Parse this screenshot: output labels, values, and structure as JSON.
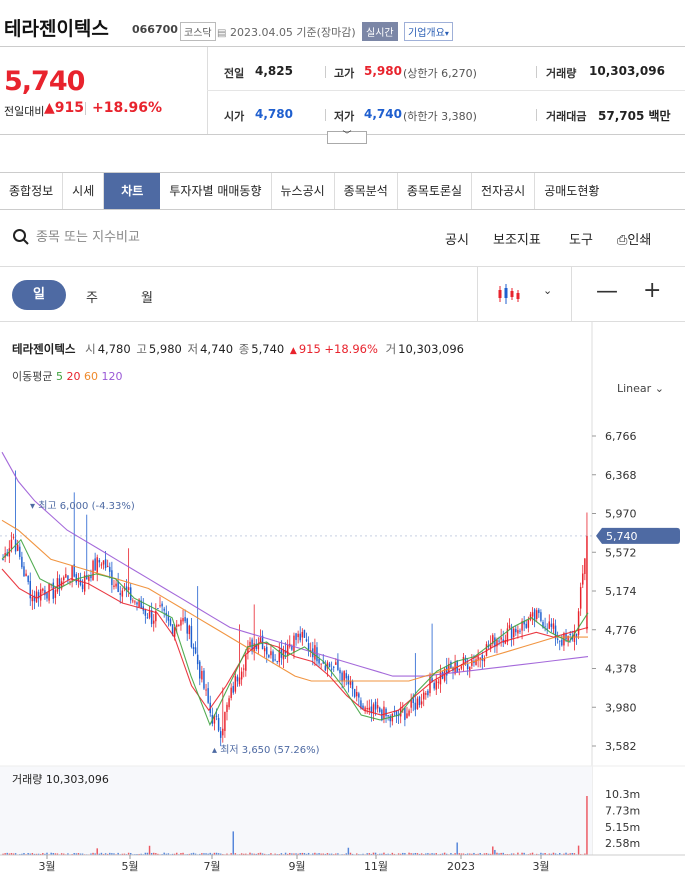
{
  "header": {
    "name": "테라젠이텍스",
    "code": "066700",
    "market": "코스닥",
    "date": "2023.04.05 기준(장마감)",
    "live": "실시간",
    "company_info": "기업개요"
  },
  "quote": {
    "price": "5,740",
    "change_label": "전일대비",
    "change_amount": "915",
    "change_pct": "+18.96%",
    "stats": {
      "prev_label": "전일",
      "prev_value": "4,825",
      "high_label": "고가",
      "high_value": "5,980",
      "upper_limit": "(상한가 6,270)",
      "volume_label": "거래량",
      "volume_value": "10,303,096",
      "open_label": "시가",
      "open_value": "4,780",
      "low_label": "저가",
      "low_value": "4,740",
      "lower_limit": "(하한가 3,380)",
      "amount_label": "거래대금",
      "amount_value": "57,705",
      "amount_unit": "백만"
    }
  },
  "tabs": [
    "종합정보",
    "시세",
    "차트",
    "투자자별 매매동향",
    "뉴스공시",
    "종목분석",
    "종목토론실",
    "전자공시",
    "공매도현황"
  ],
  "active_tab": 2,
  "toolbar": {
    "search_placeholder": "종목 또는 지수비교",
    "disclosure": "공시",
    "indicators": "보조지표",
    "tools": "도구",
    "print": "인쇄"
  },
  "periods": {
    "day": "일",
    "week": "주",
    "month": "월"
  },
  "colors": {
    "up": "#e8232d",
    "down": "#1f5fcf",
    "accent": "#4e6aa3",
    "ma5": "#3fa33f",
    "ma20": "#e8232d",
    "ma60": "#ef8a2c",
    "ma120": "#9a59d6"
  },
  "legend": {
    "name": "테라젠이텍스",
    "open_k": "시",
    "open_v": "4,780",
    "high_k": "고",
    "high_v": "5,980",
    "low_k": "저",
    "low_v": "4,740",
    "close_k": "종",
    "close_v": "5,740",
    "change": "915 +18.96%",
    "vol_k": "거",
    "vol_v": "10,303,096",
    "ma_label": "이동평균",
    "ma": [
      "5",
      "20",
      "60",
      "120"
    ],
    "scale": "Linear"
  },
  "chart_data": {
    "type": "candlestick",
    "y_ticks": [
      "6,766",
      "6,368",
      "5,970",
      "5,572",
      "5,174",
      "4,776",
      "4,378",
      "3,980",
      "3,582"
    ],
    "ylim": [
      3582,
      6766
    ],
    "current_price_label": "5,740",
    "high_annotation": "최고 6,000 (-4.33%)",
    "low_annotation": "최저 3,650 (57.26%)",
    "x_labels": [
      "3월",
      "5월",
      "7월",
      "9월",
      "11월",
      "2023",
      "3월"
    ],
    "volume_label": "거래량 10,303,096",
    "volume_ticks": [
      "10.3m",
      "7.73m",
      "5.15m",
      "2.58m"
    ],
    "close_trend": [
      5500,
      5750,
      5400,
      5100,
      5200,
      5150,
      5300,
      5350,
      5250,
      5400,
      5500,
      5300,
      5200,
      5100,
      5000,
      4900,
      4950,
      4800,
      4900,
      4700,
      4300,
      3900,
      3750,
      4100,
      4400,
      4600,
      4700,
      4500,
      4550,
      4650,
      4700,
      4600,
      4500,
      4400,
      4350,
      4200,
      4000,
      3900,
      3950,
      3850,
      3900,
      3950,
      4050,
      4200,
      4300,
      4350,
      4400,
      4450,
      4500,
      4600,
      4700,
      4750,
      4800,
      4850,
      4900,
      4850,
      4700,
      4650,
      4780,
      5740
    ],
    "ma120_trend": [
      6600,
      6300,
      6100,
      5950,
      5800,
      5700,
      5600,
      5500,
      5400,
      5300,
      5200,
      5100,
      5000,
      4900,
      4800,
      4750,
      4700,
      4650,
      4600,
      4550,
      4500,
      4450,
      4400,
      4350,
      4300,
      4300,
      4300,
      4320,
      4340,
      4360,
      4380,
      4400,
      4420,
      4440,
      4460,
      4480,
      4500
    ],
    "ma60_trend": [
      5900,
      5800,
      5650,
      5500,
      5450,
      5400,
      5350,
      5300,
      5250,
      5200,
      5100,
      5000,
      4900,
      4800,
      4700,
      4600,
      4500,
      4400,
      4300,
      4250,
      4250,
      4250,
      4250,
      4250,
      4250,
      4250,
      4300,
      4350,
      4400,
      4450,
      4500,
      4550,
      4600,
      4650,
      4700,
      4700,
      4700
    ],
    "ma20_trend": [
      5400,
      5200,
      5100,
      5200,
      5300,
      5250,
      5150,
      5050,
      5000,
      4950,
      4700,
      4200,
      3950,
      4200,
      4500,
      4650,
      4600,
      4500,
      4450,
      4300,
      4100,
      3950,
      3900,
      3950,
      4100,
      4250,
      4350,
      4450,
      4550,
      4650,
      4700,
      4750,
      4700,
      4750,
      4800
    ],
    "ma5_trend": [
      5500,
      5700,
      5300,
      5200,
      5300,
      5350,
      5300,
      5100,
      5000,
      4900,
      4300,
      3800,
      4200,
      4600,
      4650,
      4500,
      4600,
      4450,
      4200,
      3900,
      3850,
      3900,
      4150,
      4350,
      4450,
      4500,
      4650,
      4800,
      4900,
      4750,
      4650,
      4950
    ]
  }
}
